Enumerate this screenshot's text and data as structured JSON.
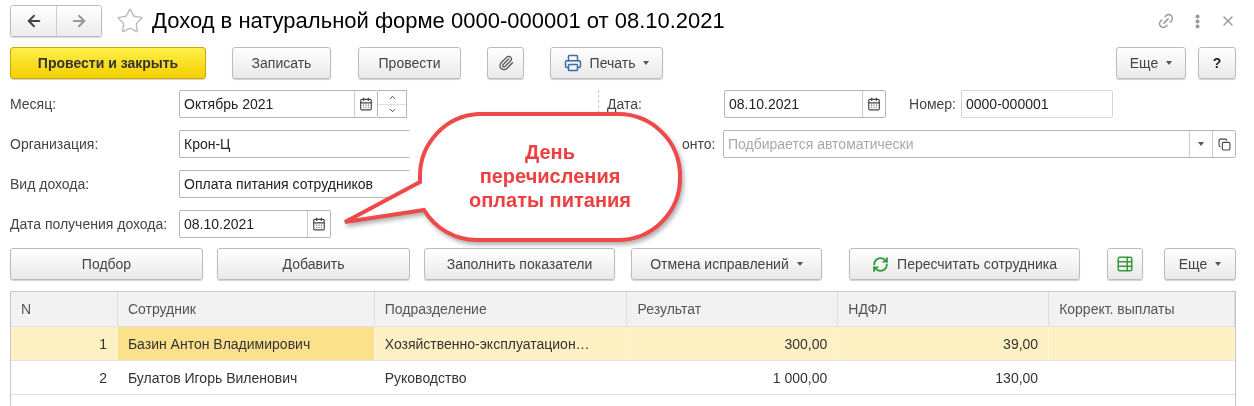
{
  "window": {
    "title": "Доход в натуральной форме 0000-000001 от 08.10.2021"
  },
  "toolbar": {
    "buttons": [
      {
        "kind": "primary",
        "label": "Провести и закрыть"
      },
      {
        "kind": "plain",
        "label": "Записать"
      },
      {
        "kind": "plain",
        "label": "Провести"
      },
      {
        "kind": "attach"
      },
      {
        "kind": "print",
        "label": "Печать"
      }
    ],
    "more": "Еще",
    "help": "?"
  },
  "form": {
    "left": [
      {
        "kind": "month",
        "label": "Месяц:",
        "value": "Октябрь 2021"
      },
      {
        "kind": "text",
        "label": "Организация:",
        "value": "Крон-Ц"
      },
      {
        "kind": "text",
        "label": "Вид дохода:",
        "value": "Оплата питания сотрудников"
      },
      {
        "kind": "date",
        "label": "Дата получения дохода:",
        "value": "08.10.2021"
      }
    ],
    "date": {
      "label": "Дата:",
      "value": "08.10.2021"
    },
    "number": {
      "label": "Номер:",
      "value": "0000-000001"
    },
    "account": {
      "label": "онто:",
      "placeholder": "Подбирается автоматически"
    }
  },
  "table_buttons": [
    {
      "kind": "plain",
      "label": "Подбор"
    },
    {
      "kind": "plain",
      "label": "Добавить"
    },
    {
      "kind": "plain",
      "label": "Заполнить показатели"
    },
    {
      "kind": "dropdown",
      "label": "Отмена исправлений"
    },
    {
      "kind": "refresh",
      "label": "Пересчитать сотрудника"
    },
    {
      "kind": "table-add"
    },
    {
      "kind": "dropdown",
      "label": "Еще"
    }
  ],
  "table": {
    "columns": [
      {
        "label": "N"
      },
      {
        "label": "Сотрудник"
      },
      {
        "label": "Подразделение"
      },
      {
        "label": "Результат"
      },
      {
        "label": "НДФЛ"
      },
      {
        "label": "Коррект. выплаты"
      }
    ],
    "rows": [
      {
        "selected": true,
        "cells": [
          {
            "text": "1",
            "focused": false
          },
          {
            "text": "Базин Антон Владимирович",
            "focused": true
          },
          {
            "text": "Хозяйственно-эксплуатацион…",
            "focused": false
          },
          {
            "text": "300,00",
            "focused": false
          },
          {
            "text": "39,00",
            "focused": false
          },
          {
            "focused": false
          }
        ]
      },
      {
        "selected": false,
        "cells": [
          {
            "text": "2",
            "focused": false
          },
          {
            "text": "Булатов Игорь Виленович",
            "focused": false
          },
          {
            "text": "Руководство",
            "focused": false
          },
          {
            "text": "1 000,00",
            "focused": false
          },
          {
            "text": "130,00",
            "focused": false
          },
          {
            "focused": false
          }
        ]
      }
    ]
  },
  "callout": {
    "text": "День перечисления оплаты питания"
  }
}
